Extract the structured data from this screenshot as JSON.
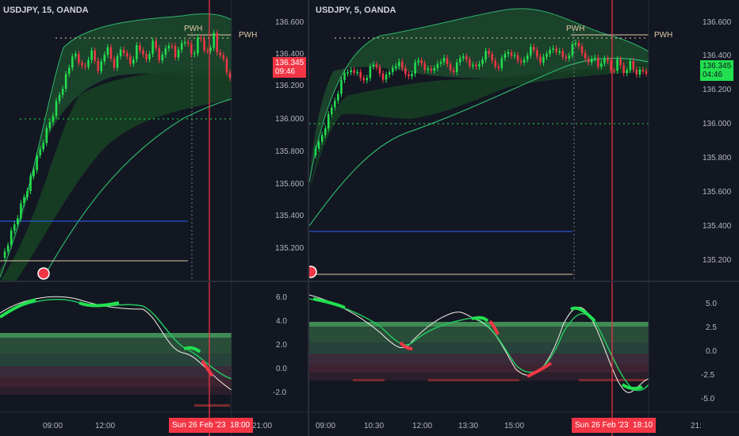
{
  "left": {
    "symbol": "USDJPY, 15, OANDA",
    "price_ticks": [
      "136.600",
      "136.400",
      "136.200",
      "136.000",
      "135.800",
      "135.600",
      "135.400",
      "135.200"
    ],
    "indicator_ticks": [
      "6.0",
      "4.0",
      "2.0",
      "0.0",
      "-2.0"
    ],
    "time_ticks": [
      "09:00",
      "12:00",
      "21:00"
    ],
    "price_badge": {
      "price": "136.345",
      "countdown": "09:46"
    },
    "date_badge": {
      "date": "Sun 26 Feb '23",
      "time": "18:00"
    },
    "pwh_labels": [
      "PWH",
      "PWH"
    ]
  },
  "right": {
    "symbol": "USDJPY, 5, OANDA",
    "price_ticks": [
      "136.600",
      "136.400",
      "136.200",
      "136.000",
      "135.800",
      "135.600",
      "135.400",
      "135.200"
    ],
    "indicator_ticks": [
      "5.0",
      "2.5",
      "0.0",
      "-2.5",
      "-5.0"
    ],
    "time_ticks": [
      "09:00",
      "10:30",
      "12:00",
      "13:30",
      "15:00",
      "21:"
    ],
    "price_badge": {
      "price": "136.345",
      "countdown": "04:46"
    },
    "date_badge": {
      "date": "Sun 26 Feb '23",
      "time": "18:10"
    },
    "pwh_labels": [
      "PWH",
      "PWH"
    ]
  },
  "colors": {
    "background": "#131722",
    "bull": "#22e04f",
    "bear": "#f23645",
    "ema_fill": "#1f5a33",
    "cursor": "#f23645",
    "pwh": "#e0c9a6",
    "support": "#2962ff"
  }
}
